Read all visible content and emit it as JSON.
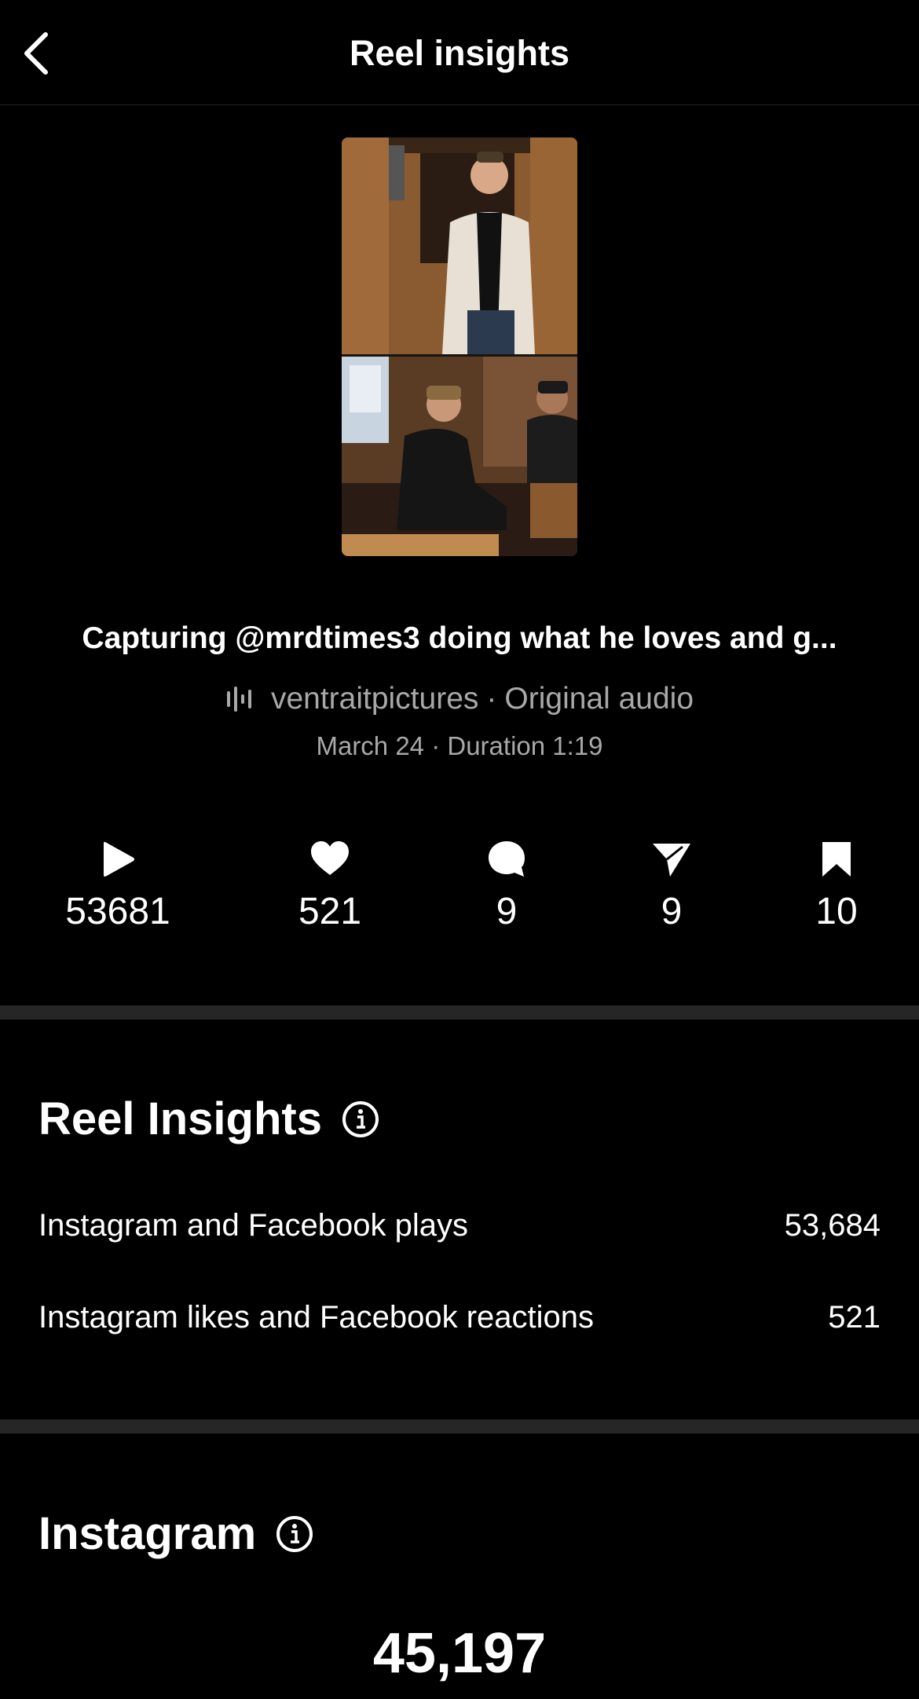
{
  "header": {
    "title": "Reel insights",
    "back_icon": "chevron-left-icon"
  },
  "reel": {
    "caption": "Capturing @mrdtimes3 doing what he loves and g...",
    "audio_icon": "audio-waveform-icon",
    "audio_author": "ventraitpictures",
    "audio_separator": "·",
    "audio_label": "Original audio",
    "date": "March 24",
    "meta_separator": "·",
    "duration": "Duration 1:19"
  },
  "stats": [
    {
      "icon": "play-icon",
      "value": "53681"
    },
    {
      "icon": "heart-icon",
      "value": "521"
    },
    {
      "icon": "comment-icon",
      "value": "9"
    },
    {
      "icon": "share-icon",
      "value": "9"
    },
    {
      "icon": "bookmark-icon",
      "value": "10"
    }
  ],
  "reel_insights": {
    "title": "Reel Insights",
    "rows": [
      {
        "label": "Instagram and Facebook plays",
        "value": "53,684"
      },
      {
        "label": "Instagram likes and Facebook reactions",
        "value": "521"
      }
    ]
  },
  "instagram": {
    "title": "Instagram",
    "big_value": "45,197"
  },
  "colors": {
    "background": "#000000",
    "text": "#ffffff",
    "secondary_text": "#a8a8a8",
    "divider": "#262626"
  }
}
